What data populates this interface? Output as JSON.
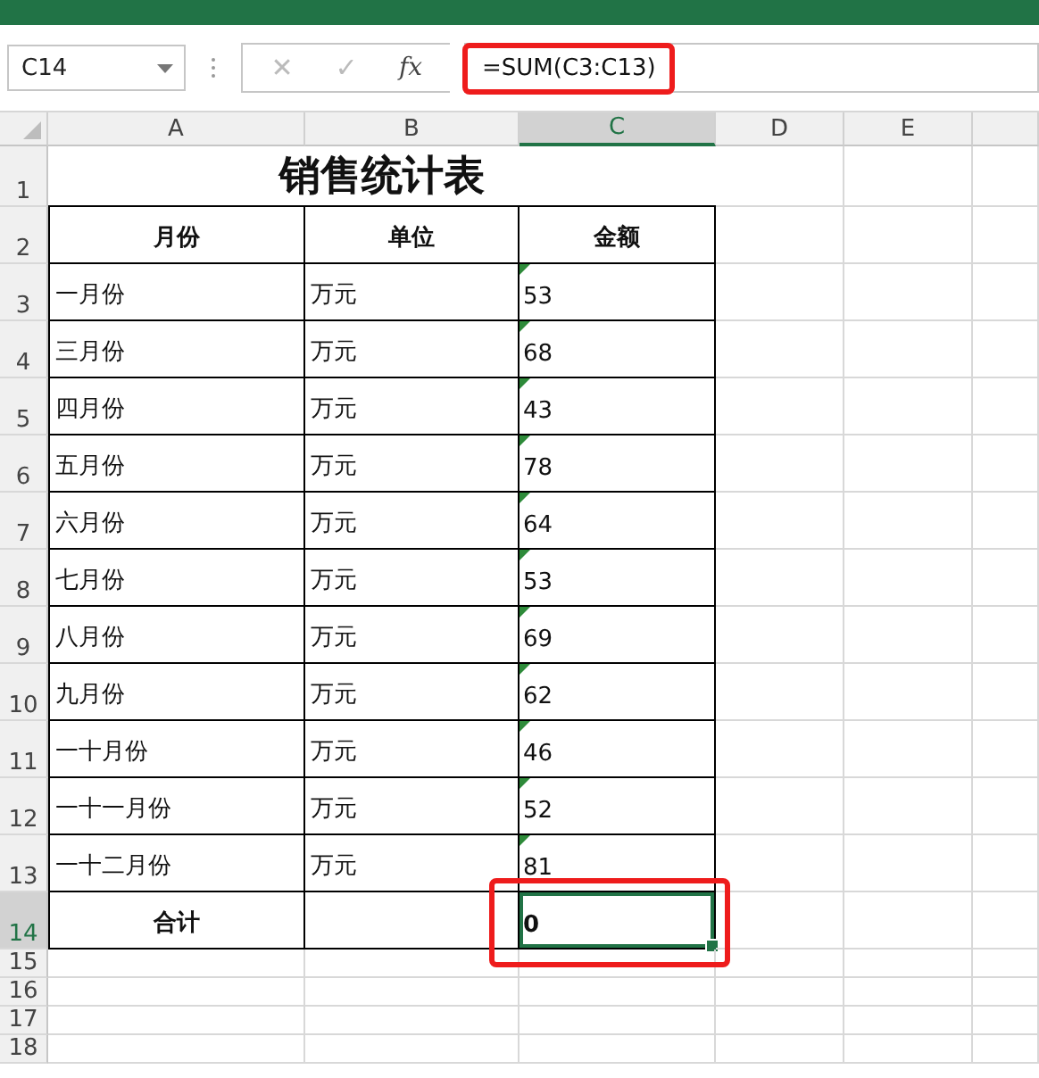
{
  "formula_bar": {
    "name_box": "C14",
    "cancel": "✕",
    "enter": "✓",
    "function_button": "fx",
    "formula": "=SUM(C3:C13)",
    "highlighted": true
  },
  "columns": [
    {
      "label": "A",
      "selected": false
    },
    {
      "label": "B",
      "selected": false
    },
    {
      "label": "C",
      "selected": true
    },
    {
      "label": "D",
      "selected": false
    },
    {
      "label": "E",
      "selected": false
    }
  ],
  "row_numbers": [
    {
      "label": "1",
      "selected": false
    },
    {
      "label": "2",
      "selected": false
    },
    {
      "label": "3",
      "selected": false
    },
    {
      "label": "4",
      "selected": false
    },
    {
      "label": "5",
      "selected": false
    },
    {
      "label": "6",
      "selected": false
    },
    {
      "label": "7",
      "selected": false
    },
    {
      "label": "8",
      "selected": false
    },
    {
      "label": "9",
      "selected": false
    },
    {
      "label": "10",
      "selected": false
    },
    {
      "label": "11",
      "selected": false
    },
    {
      "label": "12",
      "selected": false
    },
    {
      "label": "13",
      "selected": false
    },
    {
      "label": "14",
      "selected": true
    },
    {
      "label": "15",
      "selected": false
    },
    {
      "label": "16",
      "selected": false
    },
    {
      "label": "17",
      "selected": false
    },
    {
      "label": "18",
      "selected": false
    }
  ],
  "title": "销售统计表",
  "header": [
    "月份",
    "单位",
    "金额"
  ],
  "data_rows": [
    {
      "month": "一月份",
      "unit": "万元",
      "amount": "53",
      "warning": true
    },
    {
      "month": "三月份",
      "unit": "万元",
      "amount": "68",
      "warning": true
    },
    {
      "month": "四月份",
      "unit": "万元",
      "amount": "43",
      "warning": true
    },
    {
      "month": "五月份",
      "unit": "万元",
      "amount": "78",
      "warning": true
    },
    {
      "month": "六月份",
      "unit": "万元",
      "amount": "64",
      "warning": true
    },
    {
      "month": "七月份",
      "unit": "万元",
      "amount": "53",
      "warning": true
    },
    {
      "month": "八月份",
      "unit": "万元",
      "amount": "69",
      "warning": true
    },
    {
      "month": "九月份",
      "unit": "万元",
      "amount": "62",
      "warning": true
    },
    {
      "month": "一十月份",
      "unit": "万元",
      "amount": "46",
      "warning": true
    },
    {
      "month": "一十一月份",
      "unit": "万元",
      "amount": "52",
      "warning": true
    },
    {
      "month": "一十二月份",
      "unit": "万元",
      "amount": "81",
      "warning": true
    }
  ],
  "total": {
    "label": "合计",
    "value": "0",
    "selected": true,
    "highlighted": true
  }
}
